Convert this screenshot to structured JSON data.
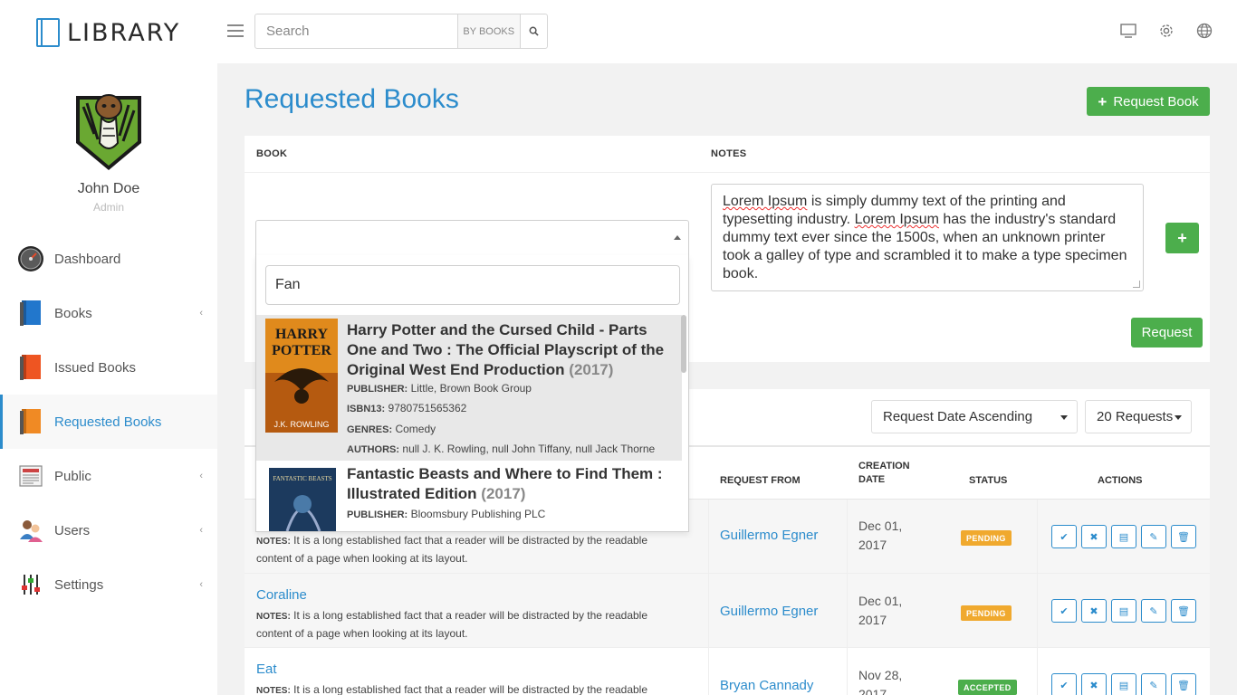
{
  "app": {
    "logo_text": "LIBRARY"
  },
  "header": {
    "search_placeholder": "Search",
    "search_scope": "BY BOOKS",
    "icons": [
      "monitor-icon",
      "gear-icon",
      "globe-icon"
    ]
  },
  "user": {
    "name": "John Doe",
    "role": "Admin"
  },
  "sidebar": {
    "items": [
      {
        "label": "Dashboard",
        "icon": "dashboard-gauge-icon",
        "has_submenu": false,
        "active": false
      },
      {
        "label": "Books",
        "icon": "blue-book-icon",
        "has_submenu": true,
        "active": false
      },
      {
        "label": "Issued Books",
        "icon": "red-book-icon",
        "has_submenu": false,
        "active": false
      },
      {
        "label": "Requested Books",
        "icon": "orange-book-icon",
        "has_submenu": false,
        "active": true
      },
      {
        "label": "Public",
        "icon": "newspaper-icon",
        "has_submenu": true,
        "active": false
      },
      {
        "label": "Users",
        "icon": "users-icon",
        "has_submenu": true,
        "active": false
      },
      {
        "label": "Settings",
        "icon": "sliders-icon",
        "has_submenu": true,
        "active": false
      }
    ]
  },
  "page": {
    "title": "Requested Books",
    "request_book_button": "Request Book"
  },
  "form": {
    "book_header": "BOOK",
    "notes_header": "NOTES",
    "notes_segments": [
      {
        "t": "Lorem Ipsum",
        "sq": true
      },
      {
        "t": " is simply dummy text of the printing and typesetting industry. ",
        "sq": false
      },
      {
        "t": "Lorem Ipsum",
        "sq": true
      },
      {
        "t": " has the industry's standard dummy text ever since the 1500s, when an unknown printer took a galley of type and scrambled it to make a type specimen book.",
        "sq": false
      }
    ],
    "request_button": "Request"
  },
  "dropdown": {
    "search_value": "Fan",
    "results": [
      {
        "title": "Harry Potter and the Cursed Child - Parts One and Two : The Official Playscript of the Original West End Production",
        "year": "(2017)",
        "publisher_label": "PUBLISHER:",
        "publisher": "Little, Brown Book Group",
        "isbn_label": "ISBN13:",
        "isbn": "9780751565362",
        "genres_label": "GENRES:",
        "genres": "Comedy",
        "authors_label": "AUTHORS:",
        "authors": "null J. K. Rowling, null John Tiffany, null Jack Thorne",
        "cover_text": [
          "HARRY",
          "POTTER",
          "J.K. ROWLING"
        ]
      },
      {
        "title": "Fantastic Beasts and Where to Find Them : Illustrated Edition",
        "year": "(2017)",
        "publisher_label": "PUBLISHER:",
        "publisher": "Bloomsbury Publishing PLC",
        "cover_text": [
          "FANTASTIC BEASTS"
        ]
      }
    ]
  },
  "list": {
    "sort_value": "Request Date Ascending",
    "count_value": "20 Requests",
    "headers": {
      "request_from": "REQUEST FROM",
      "creation_date": [
        "CREATION",
        "DATE"
      ],
      "status": "STATUS",
      "actions": "ACTIONS"
    },
    "notes_label": "NOTES:",
    "rows": [
      {
        "title": "",
        "notes": "It is a long established fact that a reader will be distracted by the readable content of a page when looking at its layout.",
        "request_from": "Guillermo Egner",
        "date": [
          "Dec 01,",
          "2017"
        ],
        "status": "PENDING",
        "status_color": "#f0a92e"
      },
      {
        "title": "Coraline",
        "notes": "It is a long established fact that a reader will be distracted by the readable content of a page when looking at its layout.",
        "request_from": "Guillermo Egner",
        "date": [
          "Dec 01,",
          "2017"
        ],
        "status": "PENDING",
        "status_color": "#f0a92e"
      },
      {
        "title": "Eat",
        "notes": "It is a long established fact that a reader will be distracted by the readable",
        "request_from": "Bryan Cannady",
        "date": [
          "Nov 28,",
          "2017"
        ],
        "status": "ACCEPTED",
        "status_color": "#4cae4c"
      }
    ]
  },
  "colors": {
    "accent": "#2c8ccc",
    "green": "#4cae4c",
    "pending": "#f0a92e"
  }
}
